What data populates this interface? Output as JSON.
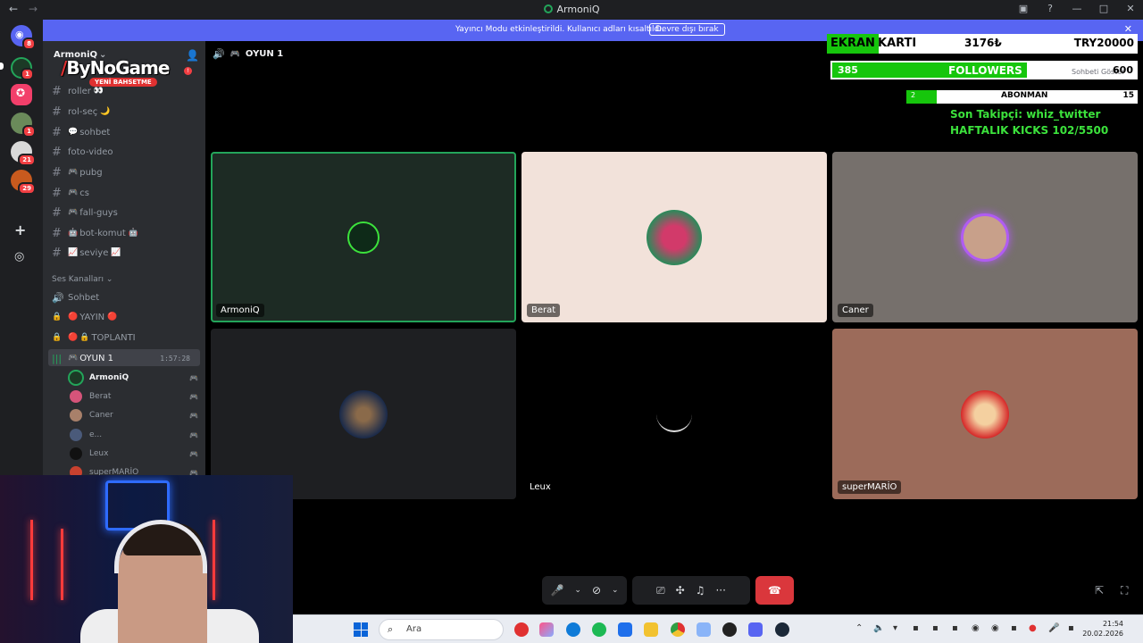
{
  "window": {
    "title": "ArmoniQ"
  },
  "promo": {
    "text": "Yayıncı Modu etkinleştirildi. Kullanıcı adları kısaltıldı.",
    "button": "Devre dışı bırak"
  },
  "server": {
    "name": "ArmoniQ",
    "logo_text": "ByNoGame",
    "logo_sub": "YENİ BAHSETME"
  },
  "server_rail": {
    "badges": [
      "8",
      "1",
      "1",
      "21",
      "29"
    ]
  },
  "channels": {
    "text": [
      {
        "label": "roller"
      },
      {
        "label": "rol-seç"
      },
      {
        "label": "sohbet"
      },
      {
        "label": "foto-video"
      },
      {
        "label": "pubg"
      },
      {
        "label": "cs"
      },
      {
        "label": "fall-guys"
      },
      {
        "label": "bot-komut"
      },
      {
        "label": "seviye"
      }
    ],
    "voice_section": "Ses Kanalları",
    "voice": [
      {
        "label": "Sohbet"
      },
      {
        "label": "YAYIN"
      },
      {
        "label": "TOPLANTI"
      },
      {
        "label": "OYUN 1",
        "timer": "1:57:28"
      }
    ],
    "members": [
      "ArmoniQ",
      "Berat",
      "Caner",
      "e...",
      "Leux",
      "superMARİO"
    ]
  },
  "header": {
    "channel": "OYUN 1"
  },
  "overlay": {
    "goal_label_1": "EKRAN",
    "goal_label_2": "KARTI",
    "goal_current": "3176₺",
    "goal_target": "TRY20000",
    "goal_progress": 0.1588,
    "followers_current": "385",
    "followers_label": "FOLLOWERS",
    "followers_target": "600",
    "followers_progress": 0.642,
    "chat_tooltip": "Sohbeti Göster",
    "subs_current": "2",
    "subs_label": "ABONMAN",
    "subs_target": "15",
    "subs_progress": 0.133,
    "last_follower": "Son Takipçi: whiz_twitter",
    "weekly_kicks": "HAFTALIK KICKS 102/5500"
  },
  "tiles": [
    {
      "name": "ArmoniQ",
      "bg": "#1d2b24",
      "speaking": true
    },
    {
      "name": "Berat",
      "bg": "#f2e2da"
    },
    {
      "name": "Caner",
      "bg": "#76706c"
    },
    {
      "name": "",
      "bg": "#1e1f22"
    },
    {
      "name": "Leux",
      "bg": "#000000"
    },
    {
      "name": "superMARİO",
      "bg": "#9c6b5a"
    }
  ],
  "taskbar": {
    "search_placeholder": "Ara",
    "time": "21:54",
    "date": "20.02.2026"
  },
  "colors": {
    "accent": "#5865f2",
    "green": "#16c60c",
    "hangup": "#da373c"
  }
}
